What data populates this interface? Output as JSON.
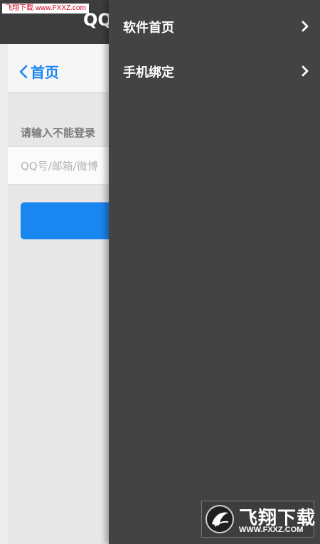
{
  "header": {
    "title": "QQ",
    "watermark": "飞翔下载 www.FXXZ.com"
  },
  "page": {
    "back_label": "首页",
    "prompt": "请输入不能登录",
    "input_placeholder": "QQ号/邮箱/微博",
    "accent_color": "#1a86f0"
  },
  "drawer": {
    "items": [
      {
        "label": "软件首页",
        "icon": "chevron-right-icon"
      },
      {
        "label": "手机绑定",
        "icon": "chevron-right-icon"
      }
    ]
  },
  "watermark": {
    "logo_text": "飞翔下载",
    "url": "WWW.FXXZ.COM"
  }
}
